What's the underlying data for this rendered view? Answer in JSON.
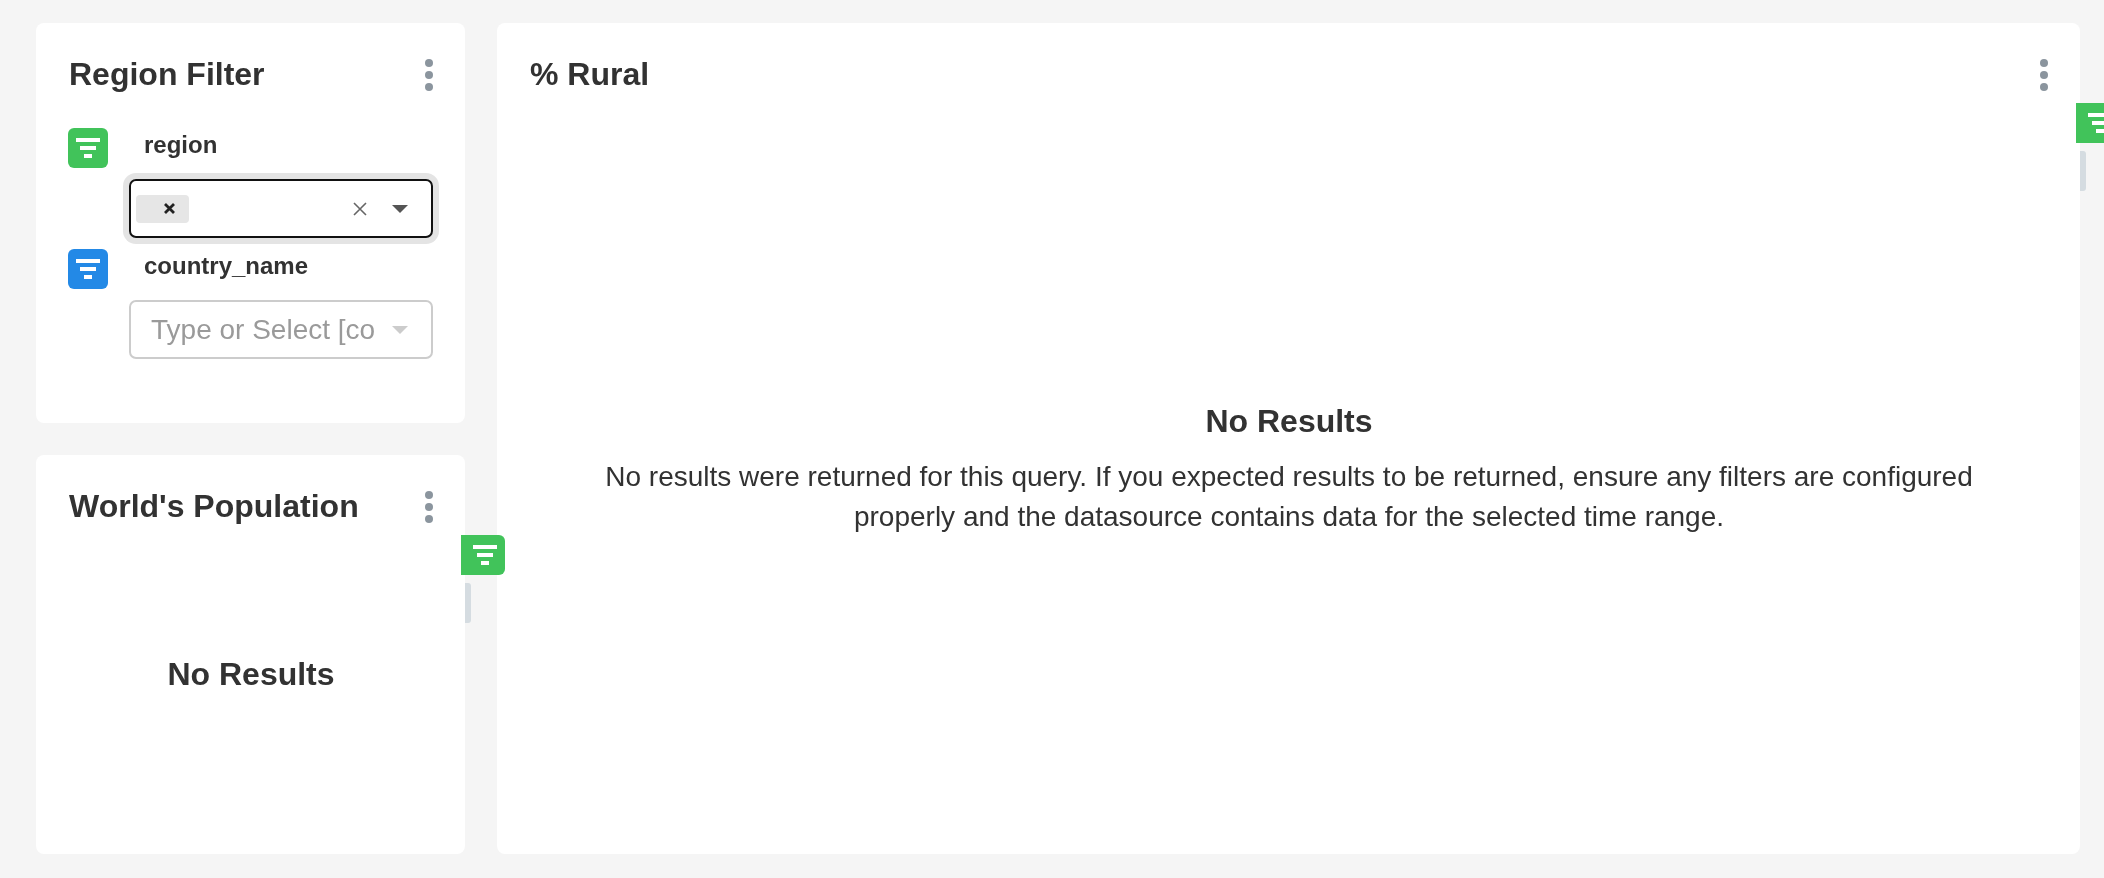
{
  "filter_box": {
    "title": "Region Filter",
    "filters": [
      {
        "label": "region",
        "color": "#41c35a",
        "focused": true,
        "has_value": true
      },
      {
        "label": "country_name",
        "color": "#2389e6",
        "focused": false,
        "has_value": false,
        "placeholder": "Type or Select [co"
      }
    ]
  },
  "charts": [
    {
      "title": "World's Population",
      "empty_title": "No Results",
      "filter_indicators": [
        {
          "color": "#41c35a"
        }
      ]
    },
    {
      "title": "% Rural",
      "empty_title": "No Results",
      "empty_message": "No results were returned for this query. If you expected results to be returned, ensure any filters are configured properly and the datasource contains data for the selected time range.",
      "filter_indicators": [
        {
          "color": "#41c35a"
        }
      ]
    }
  ]
}
